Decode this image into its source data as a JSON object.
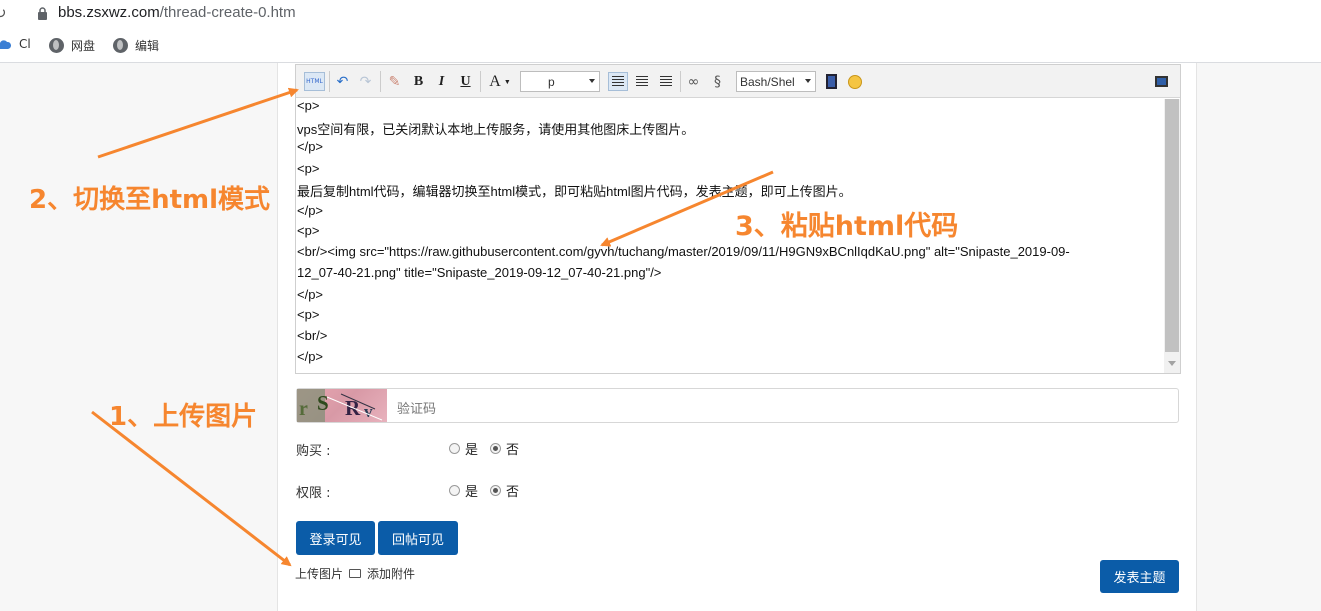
{
  "browser": {
    "url_host": "bbs.zsxwz.com",
    "url_path": "/thread-create-0.htm",
    "bookmarks": [
      {
        "label": "Cl",
        "icon": "cloud-icon"
      },
      {
        "label": "网盘",
        "icon": "globe-icon"
      },
      {
        "label": "编辑",
        "icon": "globe-icon"
      }
    ]
  },
  "toolbar": {
    "html_label": "HTML",
    "bold": "B",
    "italic": "I",
    "underline": "U",
    "font_color": "A",
    "format_value": "p",
    "code_lang_value": "Bash/Shel"
  },
  "editor": {
    "lines": [
      "<p>",
      "   vps空间有限，已关闭默认本地上传服务，请使用其他图床上传图片。",
      "</p>",
      "<p>",
      "   最后复制html代码，编辑器切换至html模式，即可粘贴html图片代码，发表主题，即可上传图片。",
      "</p>",
      "<p>",
      "   <br/><img src=\"https://raw.githubusercontent.com/gyvh/tuchang/master/2019/09/11/H9GN9xBCnlIqdKaU.png\" alt=\"Snipaste_2019-09-",
      "12_07-40-21.png\" title=\"Snipaste_2019-09-12_07-40-21.png\"/>",
      "</p>",
      "<p>",
      "   <br/>",
      "</p>"
    ]
  },
  "captcha": {
    "image_text": "rSRv",
    "placeholder": "验证码"
  },
  "options": {
    "buy_label": "购买 :",
    "perm_label": "权限 :",
    "yes": "是",
    "no": "否",
    "buy_selected": "否",
    "perm_selected": "否"
  },
  "buttons": {
    "login_visible": "登录可见",
    "reply_visible": "回帖可见",
    "publish": "发表主题"
  },
  "links": {
    "upload_image": "上传图片",
    "add_attachment": "添加附件"
  },
  "annotations": {
    "step1": "1、上传图片",
    "step2": "2、切换至html模式",
    "step3": "3、粘贴html代码"
  },
  "colors": {
    "annotation": "#f6862f",
    "primary_button": "#0b5ca8"
  }
}
